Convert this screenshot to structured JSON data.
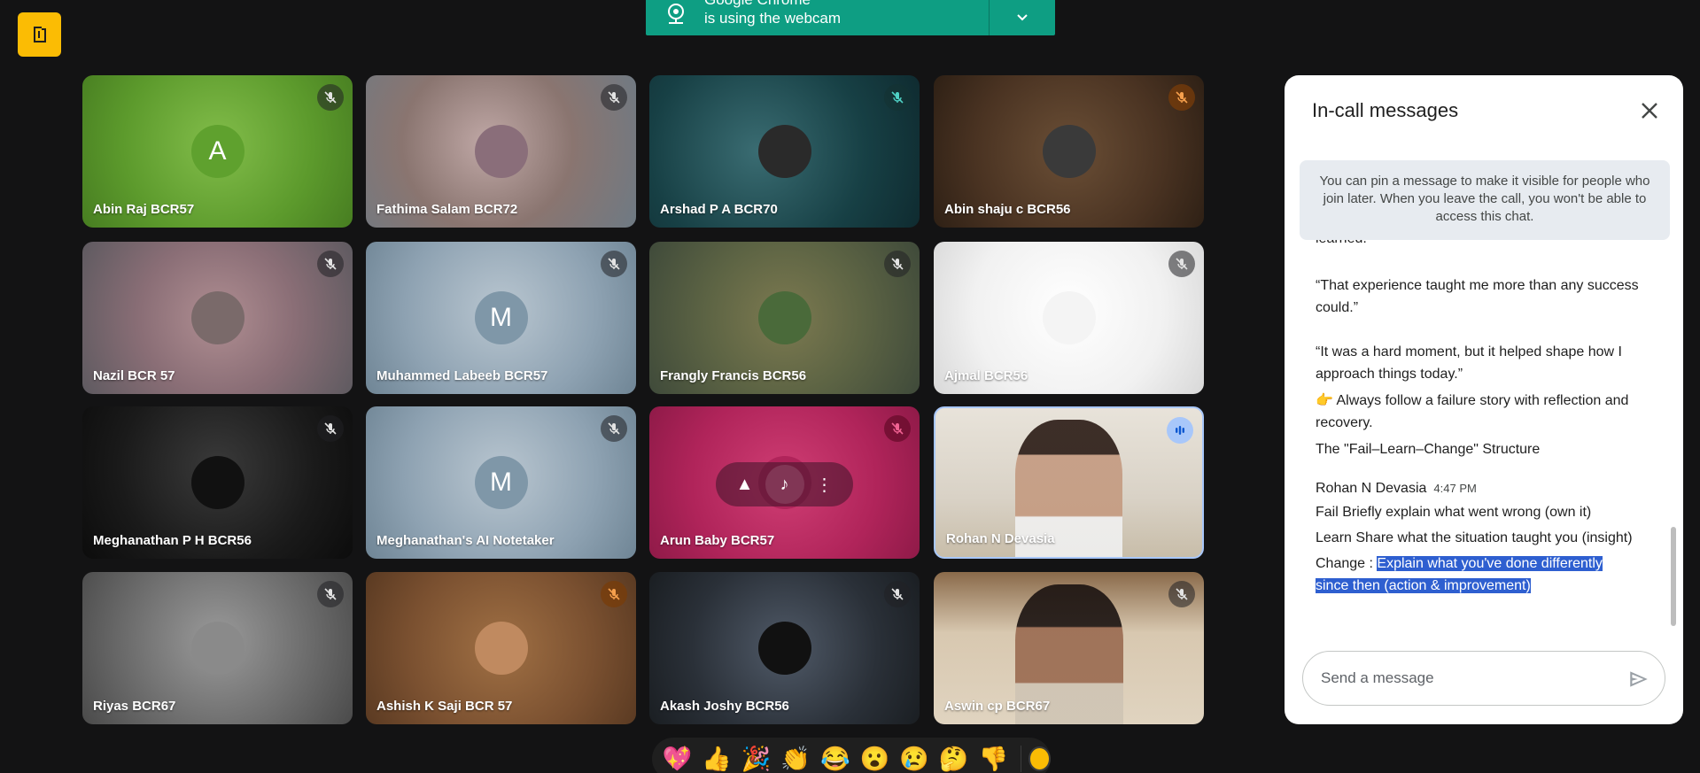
{
  "notification": {
    "line1": "Google Chrome",
    "line2": "is using the webcam"
  },
  "participants": [
    {
      "name": "Abin Raj BCR57",
      "initial": "A",
      "mic": "muted"
    },
    {
      "name": "Fathima Salam BCR72",
      "initial": "",
      "mic": "muted"
    },
    {
      "name": "Arshad P A BCR70",
      "initial": "",
      "mic": "muted-teal"
    },
    {
      "name": "Abin shaju c BCR56",
      "initial": "",
      "mic": "muted-orange"
    },
    {
      "name": "Nazil BCR 57",
      "initial": "",
      "mic": "muted"
    },
    {
      "name": "Muhammed Labeeb BCR57",
      "initial": "M",
      "mic": "muted"
    },
    {
      "name": "Frangly Francis BCR56",
      "initial": "",
      "mic": "muted"
    },
    {
      "name": "Ajmal BCR56",
      "initial": "",
      "mic": "muted"
    },
    {
      "name": "Meghanathan P H BCR56",
      "initial": "",
      "mic": "muted"
    },
    {
      "name": "Meghanathan's AI Notetaker",
      "initial": "M",
      "mic": "muted"
    },
    {
      "name": "Arun Baby BCR57",
      "initial": "",
      "mic": "muted-pink"
    },
    {
      "name": "Rohan N Devasia",
      "initial": "",
      "mic": "speaking"
    },
    {
      "name": "Riyas BCR67",
      "initial": "",
      "mic": "muted"
    },
    {
      "name": "Ashish K Saji BCR 57",
      "initial": "",
      "mic": "muted-orange"
    },
    {
      "name": "Akash Joshy BCR56",
      "initial": "",
      "mic": "muted"
    },
    {
      "name": "Aswin cp BCR67",
      "initial": "",
      "mic": "muted"
    }
  ],
  "chat": {
    "title": "In-call messages",
    "info": "You can pin a message to make it visible for people who join later. When you leave the call, you won't be able to access this chat.",
    "cut_line": "learned.",
    "quote1": "“That experience taught me more than any success could.”",
    "quote2": "“It was a hard moment, but it helped shape how I approach things today.”",
    "tip": "👉 Always follow a failure story with reflection and recovery.",
    "structure": "The \"Fail–Learn–Change\" Structure",
    "sender": "Rohan N Devasia",
    "time": "4:47 PM",
    "fail": "Fail  Briefly explain what went wrong (own it)",
    "learn": "Learn Share what the situation taught you (insight)",
    "change_prefix": "Change : ",
    "change_hl": "Explain what you've done differently since then (action & improvement)",
    "placeholder": "Send a message"
  },
  "reactions": [
    "💖",
    "👍",
    "🎉",
    "👏",
    "😂",
    "😮",
    "😢",
    "🤔",
    "👎"
  ],
  "colors": {
    "accent_yellow": "#fbbc04",
    "notify_green": "#0e9e83",
    "highlight_blue": "#2e5fd0"
  }
}
